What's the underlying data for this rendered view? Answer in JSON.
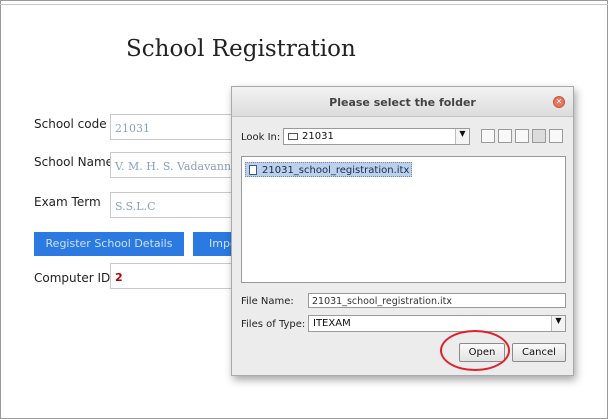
{
  "form": {
    "title": "School Registration",
    "school_code_label": "School code",
    "school_code_value": "21031",
    "school_name_label": "School Name",
    "school_name_value": "V. M. H. S. Vadavannur",
    "exam_term_label": "Exam Term",
    "exam_term_value": "S.S.L.C",
    "register_button": "Register School Details",
    "import_button": "Impo",
    "computer_id_label": "Computer ID",
    "computer_id_value": "2"
  },
  "dialog": {
    "title": "Please select the folder",
    "look_in_label": "Look In:",
    "look_in_value": "21031",
    "files": [
      "21031_school_registration.itx"
    ],
    "file_name_label": "File Name:",
    "file_name_value": "21031_school_registration.itx",
    "files_of_type_label": "Files of Type:",
    "files_of_type_value": "ITEXAM",
    "open_button": "Open",
    "cancel_button": "Cancel"
  },
  "colors": {
    "accent_blue": "#2a7ae2",
    "highlight_ring": "#e0202c"
  }
}
